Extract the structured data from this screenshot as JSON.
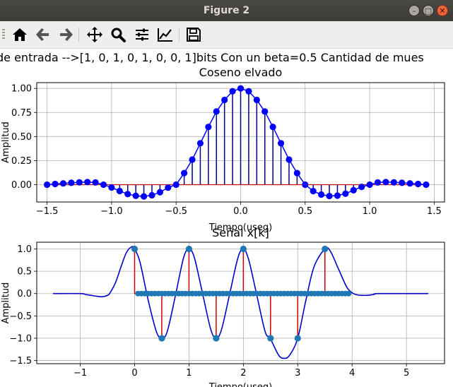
{
  "window": {
    "title": "Figure 2",
    "buttons": {
      "minimize": "–",
      "maximize": "□",
      "close": "✕"
    }
  },
  "toolbar": {
    "items": [
      {
        "name": "home-button",
        "icon": "home-icon"
      },
      {
        "name": "back-button",
        "icon": "arrow-left-icon"
      },
      {
        "name": "forward-button",
        "icon": "arrow-right-icon"
      },
      {
        "name": "pan-button",
        "icon": "move-icon"
      },
      {
        "name": "zoom-button",
        "icon": "magnifier-icon"
      },
      {
        "name": "subplots-button",
        "icon": "sliders-icon"
      },
      {
        "name": "edit-axes-button",
        "icon": "line-chart-icon"
      },
      {
        "name": "save-button",
        "icon": "floppy-disk-icon"
      }
    ]
  },
  "figure": {
    "suptitle": "de entrada -->[1, 0, 1, 0, 1, 0, 0, 1]bits  Con un beta=0.5  Cantidad de mues"
  },
  "chart_data": [
    {
      "type": "stem",
      "title": "Coseno elvado",
      "xlabel": "Tiempo(useg)",
      "ylabel": "Amplitud",
      "xlim": [
        -1.58,
        1.58
      ],
      "ylim": [
        -0.18,
        1.06
      ],
      "xticks": [
        -1.5,
        -1.0,
        -0.5,
        0.0,
        0.5,
        1.0,
        1.5
      ],
      "xtick_labels": [
        "−1.5",
        "−1.0",
        "−0.5",
        "0.0",
        "0.5",
        "1.0",
        "1.5"
      ],
      "yticks": [
        0.0,
        0.25,
        0.5,
        0.75,
        1.0
      ],
      "ytick_labels": [
        "0.00",
        "0.25",
        "0.50",
        "0.75",
        "1.00"
      ],
      "grid": true,
      "colors": {
        "marker": "#0000ff",
        "stem": "#00008b",
        "line": "#0000ff",
        "baseline": "#cc0000"
      },
      "x": [
        -1.5,
        -1.4375,
        -1.375,
        -1.3125,
        -1.25,
        -1.1875,
        -1.125,
        -1.0625,
        -1.0,
        -0.9375,
        -0.875,
        -0.8125,
        -0.75,
        -0.6875,
        -0.625,
        -0.5625,
        -0.5,
        -0.4375,
        -0.375,
        -0.3125,
        -0.25,
        -0.1875,
        -0.125,
        -0.0625,
        0.0,
        0.0625,
        0.125,
        0.1875,
        0.25,
        0.3125,
        0.375,
        0.4375,
        0.5,
        0.5625,
        0.625,
        0.6875,
        0.75,
        0.8125,
        0.875,
        0.9375,
        1.0,
        1.0625,
        1.125,
        1.1875,
        1.25,
        1.3125,
        1.375,
        1.4375
      ],
      "y": [
        0.0,
        0.007,
        0.013,
        0.019,
        0.024,
        0.027,
        0.023,
        0.0,
        -0.03,
        -0.066,
        -0.098,
        -0.116,
        -0.122,
        -0.11,
        -0.079,
        -0.031,
        0.0,
        0.12,
        0.26,
        0.43,
        0.6,
        0.76,
        0.88,
        0.97,
        1.0,
        0.97,
        0.88,
        0.76,
        0.6,
        0.43,
        0.26,
        0.12,
        0.0,
        -0.067,
        -0.103,
        -0.118,
        -0.114,
        -0.094,
        -0.058,
        -0.023,
        0.0,
        0.023,
        0.027,
        0.024,
        0.019,
        0.013,
        0.007,
        0.0
      ]
    },
    {
      "type": "line+stem",
      "title": "Señal x[k]",
      "xlabel": "Tiempo(useg)",
      "ylabel": "Amplitud",
      "xlim": [
        -1.8,
        5.7
      ],
      "ylim": [
        -1.57,
        1.15
      ],
      "xticks": [
        -1,
        0,
        1,
        2,
        3,
        4,
        5
      ],
      "xtick_labels": [
        "−1",
        "0",
        "1",
        "2",
        "3",
        "4",
        "5"
      ],
      "yticks": [
        -1.5,
        -1.0,
        -0.5,
        0.0,
        0.5,
        1.0
      ],
      "ytick_labels": [
        "−1.5",
        "−1.0",
        "−0.5",
        "0.0",
        "0.5",
        "1.0"
      ],
      "grid": true,
      "colors": {
        "line": "#0000cd",
        "stem": "#cc0000",
        "marker": "#1f77b4"
      },
      "series": [
        {
          "kind": "line",
          "x": [
            -1.5,
            -1.0,
            -0.9,
            -0.75,
            -0.6,
            -0.5,
            -0.45,
            -0.35,
            -0.25,
            -0.15,
            -0.05,
            0.0,
            0.1,
            0.25,
            0.4,
            0.5,
            0.6,
            0.75,
            0.9,
            1.0,
            1.1,
            1.25,
            1.4,
            1.5,
            1.6,
            1.75,
            1.9,
            2.0,
            2.1,
            2.25,
            2.4,
            2.5,
            2.65,
            2.75,
            2.85,
            3.0,
            3.15,
            3.3,
            3.5,
            3.6,
            3.75,
            3.9,
            4.0,
            4.1,
            4.25,
            4.4,
            4.5,
            5.4
          ],
          "y": [
            0.0,
            0.0,
            -0.02,
            -0.05,
            -0.07,
            -0.04,
            0.02,
            0.25,
            0.6,
            0.92,
            1.05,
            1.0,
            0.7,
            -0.15,
            -0.85,
            -1.0,
            -0.85,
            -0.05,
            0.8,
            1.0,
            0.8,
            0.0,
            -0.8,
            -1.0,
            -0.8,
            0.0,
            0.8,
            1.0,
            0.75,
            -0.05,
            -0.85,
            -1.02,
            -1.38,
            -1.45,
            -1.38,
            -1.0,
            -0.15,
            0.6,
            1.0,
            0.95,
            0.55,
            0.15,
            0.02,
            -0.03,
            -0.04,
            -0.02,
            0.0,
            0.0
          ]
        },
        {
          "kind": "stem",
          "x": [
            0.0,
            0.5,
            1.0,
            1.5,
            2.0,
            2.5,
            3.0,
            3.5
          ],
          "y": [
            1,
            -1,
            1,
            -1,
            1,
            -1,
            -1,
            1
          ]
        },
        {
          "kind": "zeros",
          "x_start": 0.0625,
          "x_end": 3.9375,
          "step": 0.0625,
          "y": 0.0
        }
      ]
    }
  ]
}
